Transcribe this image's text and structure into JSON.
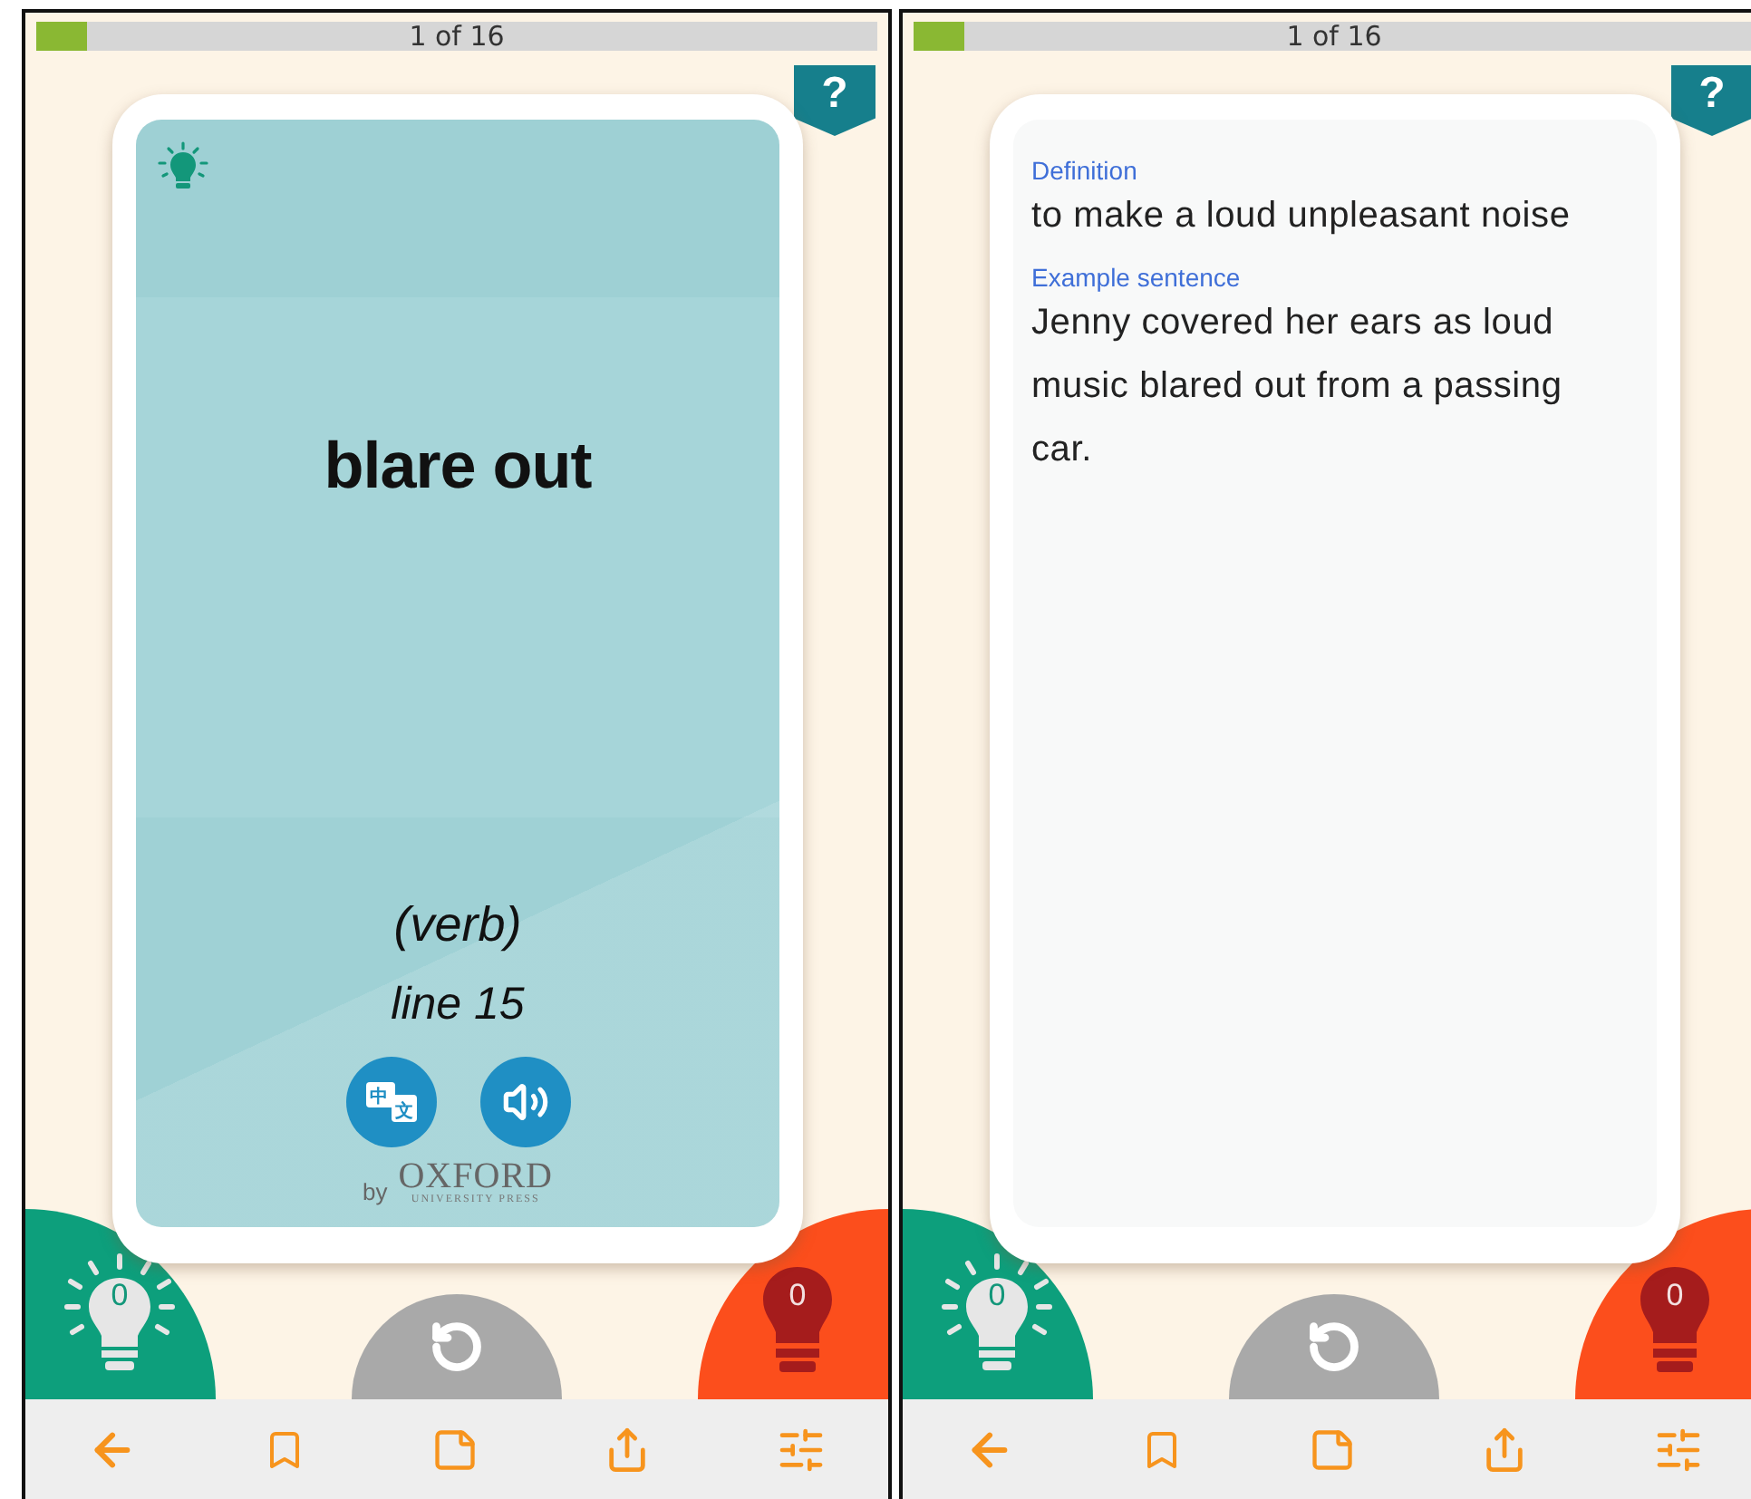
{
  "screens": [
    {
      "kind": "front",
      "progress": {
        "level": 0.06,
        "label": "1 of 16"
      },
      "help": "?",
      "card": {
        "word": "blare out",
        "part_of_speech": "(verb)",
        "reference": "line 15",
        "translate_glyphs": [
          "中",
          "文"
        ],
        "publisher": {
          "by": "by",
          "name": "OXFORD",
          "subtitle": "UNIVERSITY PRESS"
        }
      },
      "known_count": "0",
      "unknown_count": "0"
    },
    {
      "kind": "back",
      "progress": {
        "level": 0.06,
        "label": "1 of 16"
      },
      "help": "?",
      "card": {
        "sections": [
          {
            "heading": "Definition",
            "text": "to make a loud unpleasant noise"
          },
          {
            "heading": "Example sentence",
            "text": "Jenny covered her ears as loud music blared out from a passing car."
          }
        ]
      },
      "known_count": "0",
      "unknown_count": "0"
    }
  ]
}
